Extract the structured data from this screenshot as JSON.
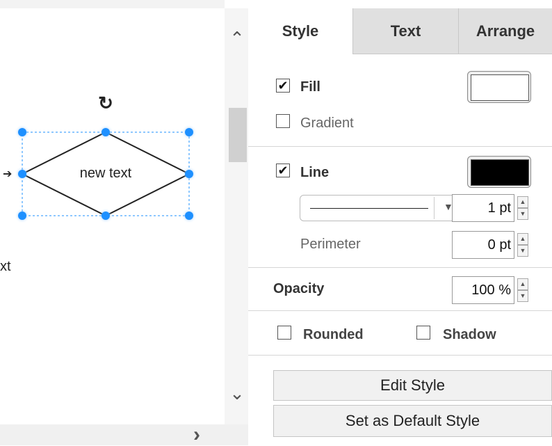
{
  "canvas": {
    "shape_text": "new text",
    "partial_text": "xt",
    "edge_arrow": "➔"
  },
  "tabs": [
    {
      "label": "Style",
      "active": true
    },
    {
      "label": "Text",
      "active": false
    },
    {
      "label": "Arrange",
      "active": false
    }
  ],
  "fill": {
    "label": "Fill",
    "checked": true,
    "color": "#ffffff"
  },
  "gradient": {
    "label": "Gradient",
    "checked": false
  },
  "line": {
    "label": "Line",
    "checked": true,
    "color": "#000000",
    "width_value": "1 pt"
  },
  "perimeter": {
    "label": "Perimeter",
    "value": "0 pt"
  },
  "opacity": {
    "label": "Opacity",
    "value": "100 %"
  },
  "rounded": {
    "label": "Rounded",
    "checked": false
  },
  "shadow": {
    "label": "Shadow",
    "checked": false
  },
  "buttons": {
    "edit_style": "Edit Style",
    "set_default": "Set as Default Style"
  },
  "icons": {
    "check": "✔",
    "scroll_up": "⌃",
    "scroll_down": "⌄",
    "scroll_right": "›",
    "rotate": "↻",
    "step_up": "▲",
    "step_down": "▼"
  }
}
